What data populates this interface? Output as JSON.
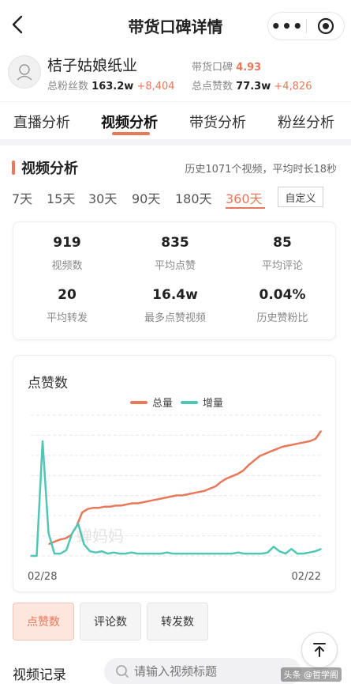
{
  "header": {
    "title": "带货口碑详情",
    "more_label": "•••"
  },
  "shop": {
    "name": "桔子姑娘纸业",
    "fans_label": "总粉丝数",
    "fans_value": "163.2w",
    "fans_delta": "+8,404",
    "reputation_label": "带货口碑",
    "reputation_value": "4.93",
    "likes_label": "总点赞数",
    "likes_value": "77.3w",
    "likes_delta": "+4,826"
  },
  "tabs": [
    {
      "label": "直播分析"
    },
    {
      "label": "视频分析"
    },
    {
      "label": "带货分析"
    },
    {
      "label": "粉丝分析"
    }
  ],
  "section": {
    "title": "视频分析",
    "note": "历史1071个视频，平均时长18秒"
  },
  "ranges": [
    "7天",
    "15天",
    "30天",
    "90天",
    "180天",
    "360天"
  ],
  "custom_label": "自定义",
  "stats": [
    {
      "value": "919",
      "label": "视频数"
    },
    {
      "value": "835",
      "label": "平均点赞"
    },
    {
      "value": "85",
      "label": "平均评论"
    },
    {
      "value": "20",
      "label": "平均转发"
    },
    {
      "value": "16.4w",
      "label": "最多点赞视频"
    },
    {
      "value": "0.04%",
      "label": "历史赞粉比"
    }
  ],
  "chart_title": "点赞数",
  "watermark": "蝉妈妈",
  "chart_data": {
    "type": "line",
    "title": "点赞数",
    "x_start_label": "02/28",
    "x_end_label": "02/22",
    "series": [
      {
        "name": "总量",
        "color": "#e8785a",
        "values": [
          0.0,
          0.02,
          0.04,
          0.05,
          0.08,
          0.16,
          0.28,
          0.31,
          0.32,
          0.32,
          0.33,
          0.33,
          0.34,
          0.34,
          0.35,
          0.36,
          0.36,
          0.37,
          0.38,
          0.39,
          0.4,
          0.41,
          0.42,
          0.43,
          0.43,
          0.44,
          0.45,
          0.46,
          0.47,
          0.49,
          0.51,
          0.55,
          0.58,
          0.6,
          0.62,
          0.65,
          0.7,
          0.74,
          0.78,
          0.8,
          0.82,
          0.84,
          0.86,
          0.87,
          0.88,
          0.89,
          0.9,
          0.91,
          0.93,
          1.0
        ]
      },
      {
        "name": "增量",
        "color": "#4fc7b4",
        "values": [
          0.0,
          0.0,
          1.0,
          0.2,
          0.02,
          0.02,
          0.05,
          0.2,
          0.28,
          0.1,
          0.04,
          0.03,
          0.04,
          0.02,
          0.03,
          0.02,
          0.02,
          0.03,
          0.02,
          0.02,
          0.02,
          0.02,
          0.02,
          0.03,
          0.02,
          0.02,
          0.02,
          0.02,
          0.02,
          0.02,
          0.02,
          0.02,
          0.02,
          0.02,
          0.02,
          0.03,
          0.02,
          0.02,
          0.02,
          0.02,
          0.03,
          0.08,
          0.04,
          0.02,
          0.06,
          0.02,
          0.02,
          0.03,
          0.04,
          0.06
        ]
      }
    ],
    "grid": true,
    "legend": "top-center"
  },
  "metric_buttons": [
    {
      "label": "点赞数"
    },
    {
      "label": "评论数"
    },
    {
      "label": "转发数"
    }
  ],
  "records": {
    "title": "视频记录",
    "search_placeholder": "请输入视频标题"
  },
  "corner_watermark": "头条 @哲学阁"
}
